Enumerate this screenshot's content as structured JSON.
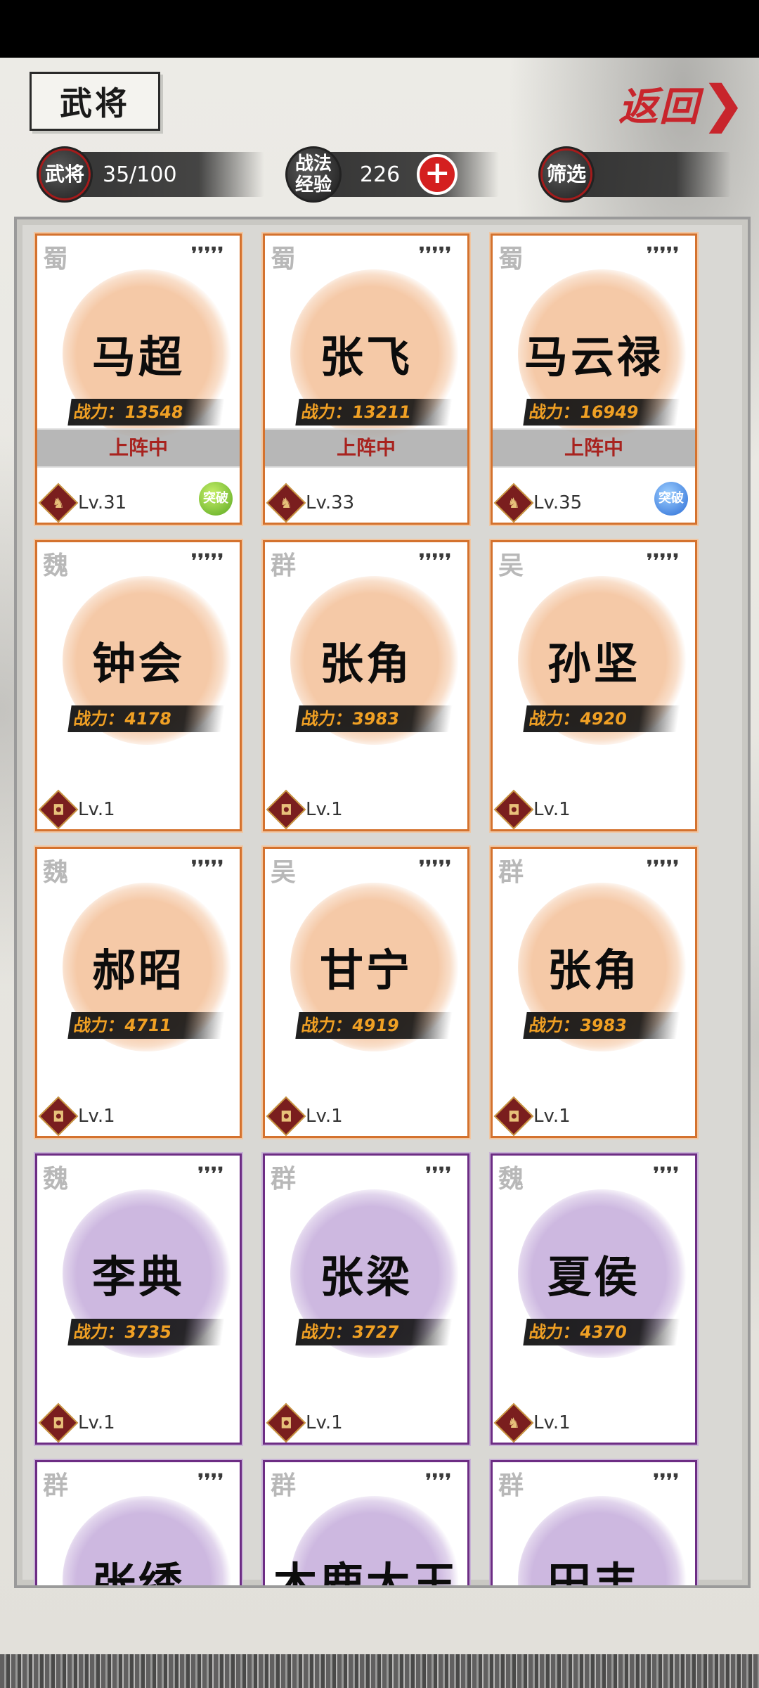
{
  "header": {
    "title": "武将",
    "back_label": "返回",
    "back_chevron": "❯"
  },
  "info": {
    "generals_seal": "武将",
    "generals_count": "35/100",
    "tactics_seal": "战法\n经验",
    "tactics_exp": "226",
    "add_label": "+",
    "filter_label": "筛选"
  },
  "colors": {
    "accent_red": "#c8252c",
    "orange_frame": "#d4722e",
    "purple_frame": "#6d2d84",
    "power_text": "#f0a024"
  },
  "cards": [
    {
      "kingdom": "蜀",
      "stars": "❜❜❜❜❜",
      "name": "马超",
      "power": "战力：13548",
      "status": "上阵中",
      "level": "Lv.31",
      "badge": "突破",
      "class_icon": "horse-icon"
    },
    {
      "kingdom": "蜀",
      "stars": "❜❜❜❜❜",
      "name": "张飞",
      "power": "战力：13211",
      "status": "上阵中",
      "level": "Lv.33",
      "badge": "",
      "class_icon": "horse-icon"
    },
    {
      "kingdom": "蜀",
      "stars": "❜❜❜❜❜",
      "name": "马云禄",
      "power": "战力：16949",
      "status": "上阵中",
      "level": "Lv.35",
      "badge": "突破",
      "class_icon": "horse-icon"
    },
    {
      "kingdom": "魏",
      "stars": "❜❜❜❜❜",
      "name": "钟会",
      "power": "战力：4178",
      "status": "",
      "level": "Lv.1",
      "badge": "",
      "class_icon": "shield-icon"
    },
    {
      "kingdom": "群",
      "stars": "❜❜❜❜❜",
      "name": "张角",
      "power": "战力：3983",
      "status": "",
      "level": "Lv.1",
      "badge": "",
      "class_icon": "shield-icon"
    },
    {
      "kingdom": "吴",
      "stars": "❜❜❜❜❜",
      "name": "孙坚",
      "power": "战力：4920",
      "status": "",
      "level": "Lv.1",
      "badge": "",
      "class_icon": "shield-icon"
    },
    {
      "kingdom": "魏",
      "stars": "❜❜❜❜❜",
      "name": "郝昭",
      "power": "战力：4711",
      "status": "",
      "level": "Lv.1",
      "badge": "",
      "class_icon": "shield-icon"
    },
    {
      "kingdom": "吴",
      "stars": "❜❜❜❜❜",
      "name": "甘宁",
      "power": "战力：4919",
      "status": "",
      "level": "Lv.1",
      "badge": "",
      "class_icon": "shield-icon"
    },
    {
      "kingdom": "群",
      "stars": "❜❜❜❜❜",
      "name": "张角",
      "power": "战力：3983",
      "status": "",
      "level": "Lv.1",
      "badge": "",
      "class_icon": "shield-icon"
    },
    {
      "kingdom": "魏",
      "stars": "❜❜❜❜",
      "name": "李典",
      "power": "战力：3735",
      "status": "",
      "level": "Lv.1",
      "badge": "",
      "class_icon": "shield-icon"
    },
    {
      "kingdom": "群",
      "stars": "❜❜❜❜",
      "name": "张梁",
      "power": "战力：3727",
      "status": "",
      "level": "Lv.1",
      "badge": "",
      "class_icon": "shield-icon"
    },
    {
      "kingdom": "魏",
      "stars": "❜❜❜❜",
      "name": "夏侯",
      "power": "战力：4370",
      "status": "",
      "level": "Lv.1",
      "badge": "",
      "class_icon": "horse-icon"
    },
    {
      "kingdom": "群",
      "stars": "❜❜❜❜",
      "name": "张绣",
      "power": "",
      "status": "",
      "level": "",
      "badge": "",
      "class_icon": ""
    },
    {
      "kingdom": "群",
      "stars": "❜❜❜❜",
      "name": "木鹿大王",
      "power": "",
      "status": "",
      "level": "",
      "badge": "",
      "class_icon": ""
    },
    {
      "kingdom": "群",
      "stars": "❜❜❜❜",
      "name": "田丰",
      "power": "",
      "status": "",
      "level": "",
      "badge": "",
      "class_icon": ""
    }
  ]
}
